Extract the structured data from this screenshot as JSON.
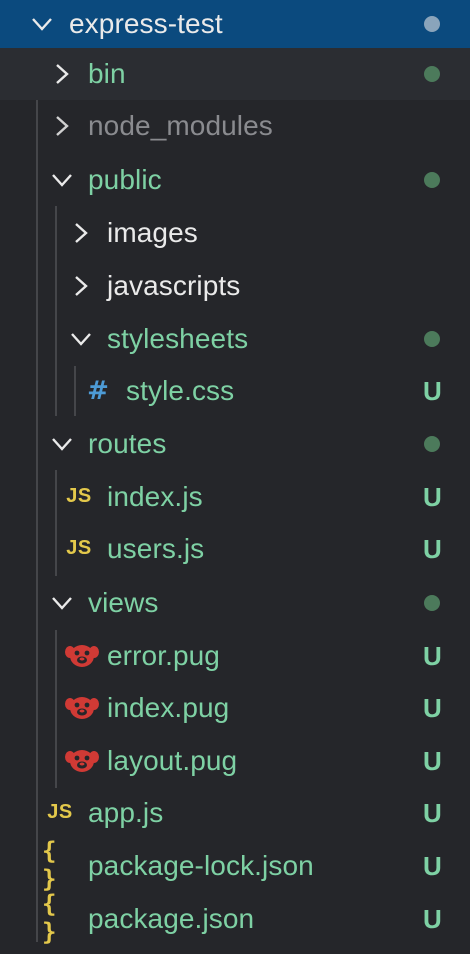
{
  "colors": {
    "root_background": "#0b4a7e",
    "hover_background": "#2b2d32",
    "sidebar_background": "#25262a",
    "modified_green": "#7ed1a4",
    "dot_color": "#4c7a5b",
    "root_dot_color": "#8aa4bb",
    "js_yellow": "#e3c84b",
    "css_blue": "#4d9bd6",
    "pug_red": "#d03a35",
    "ignored_gray": "#8a8b8f"
  },
  "tree": {
    "root": {
      "label": "express-test",
      "icon": "chevron-down-icon",
      "badge": "dot"
    },
    "items": [
      {
        "label": "bin",
        "type": "folder",
        "icon": "chevron-right-icon",
        "badge": "dot"
      },
      {
        "label": "node_modules",
        "type": "folder",
        "icon": "chevron-right-icon",
        "badge": ""
      },
      {
        "label": "public",
        "type": "folder",
        "icon": "chevron-down-icon",
        "badge": "dot"
      },
      {
        "label": "images",
        "type": "folder",
        "icon": "chevron-right-icon",
        "badge": ""
      },
      {
        "label": "javascripts",
        "type": "folder",
        "icon": "chevron-right-icon",
        "badge": ""
      },
      {
        "label": "stylesheets",
        "type": "folder",
        "icon": "chevron-down-icon",
        "badge": "dot"
      },
      {
        "label": "style.css",
        "type": "file",
        "icon": "css-hash-icon",
        "icon_glyph": "#",
        "badge": "U"
      },
      {
        "label": "routes",
        "type": "folder",
        "icon": "chevron-down-icon",
        "badge": "dot"
      },
      {
        "label": "index.js",
        "type": "file",
        "icon": "javascript-icon",
        "icon_glyph": "JS",
        "badge": "U"
      },
      {
        "label": "users.js",
        "type": "file",
        "icon": "javascript-icon",
        "icon_glyph": "JS",
        "badge": "U"
      },
      {
        "label": "views",
        "type": "folder",
        "icon": "chevron-down-icon",
        "badge": "dot"
      },
      {
        "label": "error.pug",
        "type": "file",
        "icon": "pug-dog-icon",
        "badge": "U"
      },
      {
        "label": "index.pug",
        "type": "file",
        "icon": "pug-dog-icon",
        "badge": "U"
      },
      {
        "label": "layout.pug",
        "type": "file",
        "icon": "pug-dog-icon",
        "badge": "U"
      },
      {
        "label": "app.js",
        "type": "file",
        "icon": "javascript-icon",
        "icon_glyph": "JS",
        "badge": "U"
      },
      {
        "label": "package-lock.json",
        "type": "file",
        "icon": "json-braces-icon",
        "icon_glyph": "{ }",
        "badge": "U"
      },
      {
        "label": "package.json",
        "type": "file",
        "icon": "json-braces-icon",
        "icon_glyph": "{ }",
        "badge": "U"
      }
    ]
  }
}
